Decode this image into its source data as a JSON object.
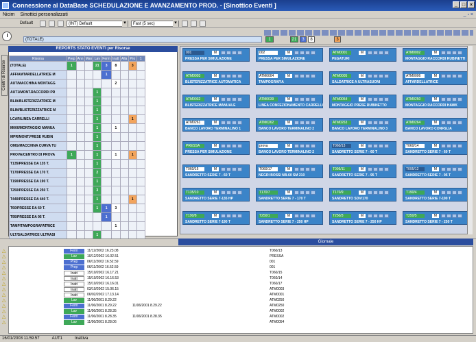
{
  "window": {
    "title": "Connessione al DataBase SCHEDULAZIONE E AVANZAMENTO PROD. - [Sinottico Eventi ]"
  },
  "menu": {
    "items": [
      "Nicim",
      "Sinottici personalizzati"
    ]
  },
  "toolbar": {
    "profile_label": "Default",
    "config_value": "(INT) Default",
    "refresh_value": "Fast (5 sec)"
  },
  "timebar": {
    "total_label": "(TOTALE)",
    "counts": [
      "1",
      "21",
      "3",
      "8",
      "3"
    ]
  },
  "reports": {
    "title": "REPORTS STATO EVENTI  per Risorse",
    "side_tab": "Centri di Risorse",
    "columns": [
      "Risorsa",
      "Prep",
      "Ann",
      "Man",
      "Lav",
      "Ferm",
      "Inatt",
      "Alla",
      "Pro",
      "1"
    ],
    "rows": [
      {
        "name": "(TOTALE)",
        "cells": [
          "1",
          "",
          "",
          "21",
          "3",
          "8",
          "",
          "3",
          ""
        ]
      },
      {
        "name": "AFF/AMTARDELLATRICE M",
        "cells": [
          "",
          "",
          "",
          "",
          "1",
          "",
          "",
          "",
          ""
        ]
      },
      {
        "name": "AUT/MACCHINA MONTAGG",
        "cells": [
          "",
          "",
          "",
          "",
          "",
          "2",
          "",
          "",
          ""
        ]
      },
      {
        "name": "AUT1/MONT.RACCORDI PR",
        "cells": [
          "",
          "",
          "",
          "1",
          "",
          "",
          "",
          "",
          ""
        ]
      },
      {
        "name": "BLIA/BLISTERIZZATRICE M",
        "cells": [
          "",
          "",
          "",
          "1",
          "",
          "",
          "",
          "",
          ""
        ]
      },
      {
        "name": "BLIM/BLISTERIZZATRICE M",
        "cells": [
          "",
          "",
          "",
          "1",
          "",
          "",
          "",
          "",
          ""
        ]
      },
      {
        "name": "LCAR/LINEA CARRELLI",
        "cells": [
          "",
          "",
          "",
          "1",
          "",
          "",
          "",
          "1",
          ""
        ]
      },
      {
        "name": "M000/MONTAGGIO MANUA",
        "cells": [
          "",
          "",
          "",
          "1",
          "",
          "1",
          "",
          "",
          ""
        ]
      },
      {
        "name": "MPR/MONT.PRESE RUBIN",
        "cells": [
          "",
          "",
          "",
          "1",
          "",
          "",
          "",
          "",
          ""
        ]
      },
      {
        "name": "OMG/MACCHINA CURVA TU",
        "cells": [
          "",
          "",
          "",
          "1",
          "",
          "",
          "",
          "",
          ""
        ]
      },
      {
        "name": "PROVA/CENTRO DI PROVA",
        "cells": [
          "1",
          "",
          "",
          "1",
          "",
          "1",
          "",
          "1",
          ""
        ]
      },
      {
        "name": "T135/PRESSE DA 135 T.",
        "cells": [
          "",
          "",
          "",
          "1",
          "",
          "",
          "",
          "",
          ""
        ]
      },
      {
        "name": "T170/PRESSE DA 170 T.",
        "cells": [
          "",
          "",
          "",
          "2",
          "",
          "",
          "",
          "",
          ""
        ]
      },
      {
        "name": "T190/PRESSE DA 190 T.",
        "cells": [
          "",
          "",
          "",
          "1",
          "",
          "",
          "",
          "",
          ""
        ]
      },
      {
        "name": "T250/PRESSE DA 250 T.",
        "cells": [
          "",
          "",
          "",
          "3",
          "",
          "",
          "",
          "",
          ""
        ]
      },
      {
        "name": "T440/PRESSE DA 440 T.",
        "cells": [
          "",
          "",
          "",
          "1",
          "",
          "",
          "",
          "1",
          ""
        ]
      },
      {
        "name": "T60/PRESSE DA 60 T.",
        "cells": [
          "",
          "",
          "",
          "1",
          "1",
          "3",
          "",
          "",
          ""
        ]
      },
      {
        "name": "T95/PRESSE DA 95 T.",
        "cells": [
          "",
          "",
          "",
          "",
          "1",
          "",
          "",
          "",
          ""
        ]
      },
      {
        "name": "TAMP/TAMPOGRAFATRICE",
        "cells": [
          "",
          "",
          "",
          "",
          "",
          "1",
          "",
          "",
          ""
        ]
      },
      {
        "name": "ULT/SALDATRICE ULTRASI",
        "cells": [
          "",
          "",
          "",
          "1",
          "",
          "",
          "",
          "",
          ""
        ]
      }
    ]
  },
  "cards": [
    {
      "code": "001",
      "desc": "PRESSA PER SIMULAZIONE",
      "style": "bl"
    },
    {
      "code": "002",
      "desc": "PRESSA PER SIMULAZIONE",
      "style": "wh"
    },
    {
      "code": "ATM0001",
      "desc": "PEGATURI",
      "style": "gr"
    },
    {
      "code": "ATM0002",
      "desc": "MONTAGGIO RACCORDI RUBINETTI",
      "style": "gr"
    },
    {
      "code": "ATM0003",
      "desc": "BLISTERIZZATRICE AUTOMATICA",
      "style": "gr"
    },
    {
      "code": "ATM0004",
      "desc": "TAMPOGRAFIA",
      "style": "wh"
    },
    {
      "code": "ATM0005",
      "desc": "SALDATRICE A ULTRASUONI",
      "style": "gr"
    },
    {
      "code": "ATM0006",
      "desc": "AFFARDELLATRICE",
      "style": "wh"
    },
    {
      "code": "ATM0032",
      "desc": "BLISTERIZZATRICE MANUALE",
      "style": "gr"
    },
    {
      "code": "ATM0039",
      "desc": "LINEA CONFEZIONAMENTO CARRELLI",
      "style": "gr"
    },
    {
      "code": "ATM0054",
      "desc": "MONTAGGIO PRESE RUBINETTO",
      "style": "gr"
    },
    {
      "code": "ATM0250",
      "desc": "MONTAGGIO RACCORDI HAWK",
      "style": "gr"
    },
    {
      "code": "ATM0261",
      "desc": "BANCO LAVORO TERMINALINO 1",
      "style": "wh"
    },
    {
      "code": "ATM0262",
      "desc": "BANCO LAVORO TERMINALINO 2",
      "style": "gr"
    },
    {
      "code": "ATM0263",
      "desc": "BANCO LAVORO TERMINALINO 3",
      "style": "gr"
    },
    {
      "code": "ATM0264",
      "desc": "BANCO LAVORO CONFSLIA",
      "style": "gr"
    },
    {
      "code": "PRESSA",
      "desc": "PRESSA PER SIMULAZIONE",
      "style": "gr"
    },
    {
      "code": "prova",
      "desc": "BANCO LAVORO TERMINALINO 2",
      "style": "wh"
    },
    {
      "code": "T060/13",
      "desc": "SANDRETTO SERIE 7 - 60 T",
      "style": "bl"
    },
    {
      "code": "T060/14",
      "desc": "SANDRETTO SERIE 7 - 60 T",
      "style": "wh"
    },
    {
      "code": "T060/15",
      "desc": "SANDRETTO SERIE 7 - 60 T",
      "style": "wh"
    },
    {
      "code": "T060/17",
      "desc": "NEGRI BOSSI NB-60 SM 210",
      "style": "wh"
    },
    {
      "code": "T095/11",
      "desc": "SANDRETTO SERIE 7 - 95 T",
      "style": "gr"
    },
    {
      "code": "T095/12",
      "desc": "SANDRETTO SERIE 7 - 95 T",
      "style": "bl"
    },
    {
      "code": "T135/10",
      "desc": "SANDRETTO SERIE 7-135 HP",
      "style": "gr"
    },
    {
      "code": "T170/7",
      "desc": "SANDRETTO SERIE 7 - 170 T",
      "style": "gr"
    },
    {
      "code": "T170/9",
      "desc": "SANDRETTO SDV/170",
      "style": "gr"
    },
    {
      "code": "T190/4",
      "desc": "SANDRETTO SERIE 7-190 T",
      "style": "gr"
    },
    {
      "code": "T190/8",
      "desc": "SANDRETTO SERIE 7-190 T",
      "style": "gr"
    },
    {
      "code": "T250/1",
      "desc": "SANDRETTO SERIE 7 - 250 HP",
      "style": "gr"
    },
    {
      "code": "T250/3",
      "desc": "SANDRETTO SERIE 7 - 250 HP",
      "style": "gr"
    },
    {
      "code": "T250/5",
      "desc": "SANDRETTO SERIE 7 - 250 T",
      "style": "gr"
    }
  ],
  "log": {
    "title": "Giornale",
    "rows": [
      {
        "state": "Ferm",
        "d1": "11/12/2002 16.23.08",
        "d2": "",
        "res": "T060/13",
        "color": "#4c6fd0"
      },
      {
        "state": "Lav",
        "d1": "10/12/2002 16.02.51",
        "d2": "",
        "res": "PRESSA",
        "color": "#3ea858"
      },
      {
        "state": "Prep",
        "d1": "06/11/2002 16.52.59",
        "d2": "",
        "res": "001",
        "color": "#4c6fd0"
      },
      {
        "state": "Prep",
        "d1": "06/11/2002 16.52.59",
        "d2": "",
        "res": "001",
        "color": "#4c6fd0"
      },
      {
        "state": "Inatt",
        "d1": "15/10/2002 16.17.21",
        "d2": "",
        "res": "T060/15",
        "color": "#ffffff"
      },
      {
        "state": "Inatt",
        "d1": "15/10/2002 16.16.53",
        "d2": "",
        "res": "T060/14",
        "color": "#ffffff"
      },
      {
        "state": "Inatt",
        "d1": "15/10/2002 16.16.01",
        "d2": "",
        "res": "T060/17",
        "color": "#ffffff"
      },
      {
        "state": "Inatt",
        "d1": "03/10/2002 15.06.15",
        "d2": "",
        "res": "ATM0003",
        "color": "#ffffff"
      },
      {
        "state": "Inatt",
        "d1": "06/02/2002 17.13.14",
        "d2": "",
        "res": "ATM0001",
        "color": "#ffffff"
      },
      {
        "state": "Lav",
        "d1": "11/06/2001 8.29.22",
        "d2": "",
        "res": "ATM0250",
        "color": "#3ea858"
      },
      {
        "state": "Ferm",
        "d1": "11/06/2001 8.29.22",
        "d2": "11/06/2001 8.29.22",
        "res": "ATM0250",
        "color": "#4c6fd0"
      },
      {
        "state": "Lav",
        "d1": "11/06/2001 8.28.35",
        "d2": "",
        "res": "ATM0002",
        "color": "#3ea858"
      },
      {
        "state": "Ferm",
        "d1": "11/06/2001 8.28.35",
        "d2": "11/06/2001 8.28.35",
        "res": "ATM0002",
        "color": "#4c6fd0"
      },
      {
        "state": "Lav",
        "d1": "11/06/2001 8.28.06",
        "d2": "",
        "res": "ATM0054",
        "color": "#3ea858"
      }
    ]
  },
  "status": {
    "datetime": "16/01/2003 11.59.57",
    "user": "AUT1",
    "state": "Inattiva"
  }
}
